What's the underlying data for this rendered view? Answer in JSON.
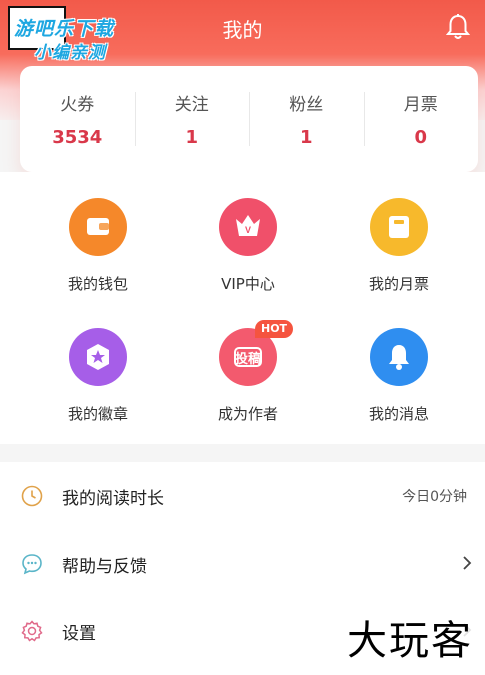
{
  "header": {
    "title": "我的",
    "watermark_line1": "游吧乐下载",
    "watermark_line2": "小编亲测"
  },
  "stats": [
    {
      "label": "火券",
      "value": "3534"
    },
    {
      "label": "关注",
      "value": "1"
    },
    {
      "label": "粉丝",
      "value": "1"
    },
    {
      "label": "月票",
      "value": "0"
    }
  ],
  "grid": [
    {
      "label": "我的钱包",
      "icon": "wallet-icon",
      "color": "#f5882a"
    },
    {
      "label": "VIP中心",
      "icon": "crown-icon",
      "color": "#f0506a"
    },
    {
      "label": "我的月票",
      "icon": "ticket-icon",
      "color": "#f7b92c"
    },
    {
      "label": "我的徽章",
      "icon": "badge-icon",
      "color": "#a65ee8"
    },
    {
      "label": "成为作者",
      "icon": "submit-manuscript-icon",
      "color": "#f35a6e",
      "badge": "HOT",
      "icon_text": "投稿"
    },
    {
      "label": "我的消息",
      "icon": "bell-icon",
      "color": "#2f8ef0"
    }
  ],
  "list": [
    {
      "label": "我的阅读时长",
      "icon": "clock-icon",
      "value": "今日0分钟"
    },
    {
      "label": "帮助与反馈",
      "icon": "chat-bubble-icon"
    },
    {
      "label": "设置",
      "icon": "gear-icon"
    }
  ],
  "corner_watermark": "大玩客",
  "colors": {
    "accent": "#f25a4a",
    "stat_value": "#d9384a"
  }
}
